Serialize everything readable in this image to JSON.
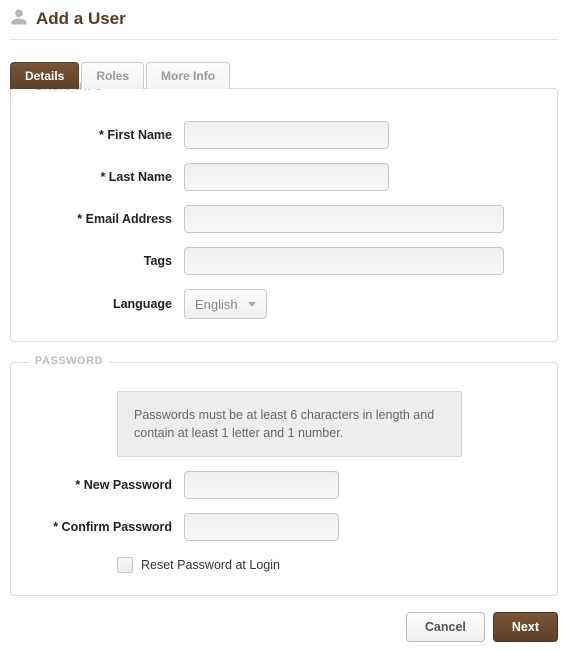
{
  "header": {
    "title": "Add a User"
  },
  "tabs": [
    {
      "label": "Details",
      "active": true
    },
    {
      "label": "Roles",
      "active": false
    },
    {
      "label": "More Info",
      "active": false
    }
  ],
  "basic_info": {
    "legend": "BASIC INFO",
    "first_name_label": "* First Name",
    "first_name_value": "",
    "last_name_label": "* Last Name",
    "last_name_value": "",
    "email_label": "* Email Address",
    "email_value": "",
    "tags_label": "Tags",
    "tags_value": "",
    "language_label": "Language",
    "language_value": "English"
  },
  "password": {
    "legend": "PASSWORD",
    "hint": "Passwords must be at least 6 characters in length and contain at least 1 letter and 1 number.",
    "new_label": "* New Password",
    "new_value": "",
    "confirm_label": "* Confirm Password",
    "confirm_value": "",
    "reset_label": "Reset Password at Login",
    "reset_checked": false
  },
  "footer": {
    "cancel_label": "Cancel",
    "next_label": "Next"
  }
}
